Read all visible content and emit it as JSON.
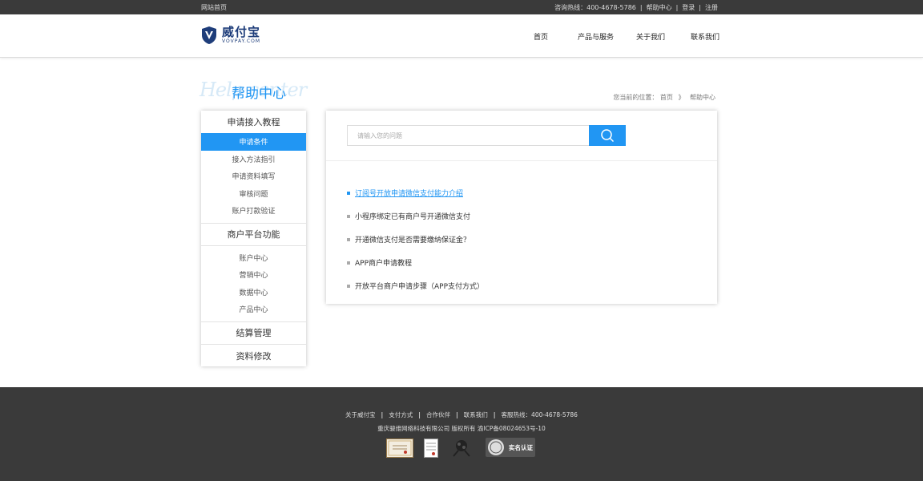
{
  "topbar": {
    "home_link": "网站首页",
    "hotline": "咨询热线：400-4678-5786",
    "help_center": "帮助中心",
    "login": "登录",
    "register": "注册"
  },
  "header": {
    "logo_cn": "威付宝",
    "logo_en": "VOVPAY.COM",
    "nav": [
      {
        "label": "首页"
      },
      {
        "label": "产品与服务"
      },
      {
        "label": "关于我们"
      },
      {
        "label": "联系我们"
      }
    ]
  },
  "page": {
    "title_script": "Help center",
    "title": "帮助中心",
    "breadcrumb_prefix": "您当前的位置：",
    "breadcrumb_home": "首页",
    "breadcrumb_sep": "》",
    "breadcrumb_current": "帮助中心"
  },
  "sidebar": {
    "groups": [
      {
        "title": "申请接入教程",
        "items": [
          {
            "label": "申请条件",
            "active": true
          },
          {
            "label": "接入方法指引"
          },
          {
            "label": "申请资料填写"
          },
          {
            "label": "审核问题"
          },
          {
            "label": "账户打款验证"
          }
        ]
      },
      {
        "title": "商户平台功能",
        "items": [
          {
            "label": "账户中心"
          },
          {
            "label": "营销中心"
          },
          {
            "label": "数据中心"
          },
          {
            "label": "产品中心"
          }
        ]
      },
      {
        "title": "结算管理",
        "items": []
      },
      {
        "title": "资料修改",
        "items": []
      }
    ]
  },
  "search": {
    "placeholder": "请输入您的问题",
    "icon": "search-icon",
    "accent": "#2196f3"
  },
  "questions": [
    {
      "text": "订阅号开放申请微信支付能力介绍",
      "active": true
    },
    {
      "text": "小程序绑定已有商户号开通微信支付"
    },
    {
      "text": "开通微信支付是否需要缴纳保证金？"
    },
    {
      "text": "APP商户申请教程"
    },
    {
      "text": "开放平台商户申请步骤（APP支付方式）"
    }
  ],
  "footer": {
    "links": [
      "关于威付宝",
      "支付方式",
      "合作伙伴",
      "联系我们"
    ],
    "hotline": "客服热线：400-4678-5786",
    "copyright": "重庆骏维网络科技有限公司 版权所有 渝ICP备08024653号-10",
    "badge_label": "实名认证"
  },
  "colors": {
    "accent": "#2196f3",
    "dark_bar": "#3a3a3a",
    "logo_blue": "#1e3d7a"
  }
}
